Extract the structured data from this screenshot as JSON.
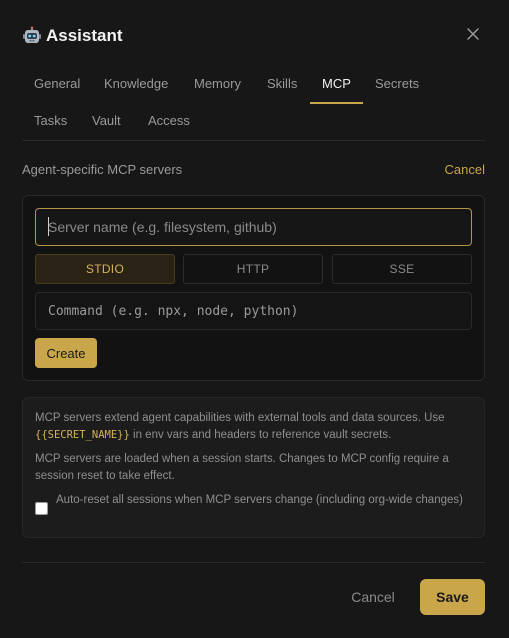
{
  "dialog": {
    "title": "Assistant",
    "icon": "robot-icon",
    "close_icon": "close-icon"
  },
  "tabs": [
    {
      "label": "General",
      "active": false
    },
    {
      "label": "Knowledge",
      "active": false
    },
    {
      "label": "Memory",
      "active": false
    },
    {
      "label": "Skills",
      "active": false
    },
    {
      "label": "MCP",
      "active": true
    },
    {
      "label": "Secrets",
      "active": false
    },
    {
      "label": "Tasks",
      "active": false
    },
    {
      "label": "Vault",
      "active": false
    },
    {
      "label": "Access",
      "active": false
    }
  ],
  "section": {
    "label": "Agent-specific MCP servers",
    "cancel_label": "Cancel"
  },
  "form": {
    "server_name_placeholder": "Server name (e.g. filesystem, github)",
    "server_name_value": "",
    "transports": [
      {
        "label": "STDIO",
        "active": true
      },
      {
        "label": "HTTP",
        "active": false
      },
      {
        "label": "SSE",
        "active": false
      }
    ],
    "command_placeholder": "Command (e.g. npx, node, python)",
    "command_value": "",
    "create_label": "Create"
  },
  "info": {
    "p1_before": "MCP servers extend agent capabilities with external tools and data sources. Use ",
    "p1_code": "{{SECRET_NAME}}",
    "p1_after": " in env vars and headers to reference vault secrets.",
    "p2": "MCP servers are loaded when a session starts. Changes to MCP config require a session reset to take effect.",
    "auto_reset_label": "Auto-reset all sessions when MCP servers change (including org-wide changes)",
    "auto_reset_checked": false
  },
  "footer": {
    "cancel_label": "Cancel",
    "save_label": "Save"
  },
  "colors": {
    "accent": "#c9a64a",
    "background": "#171717"
  }
}
